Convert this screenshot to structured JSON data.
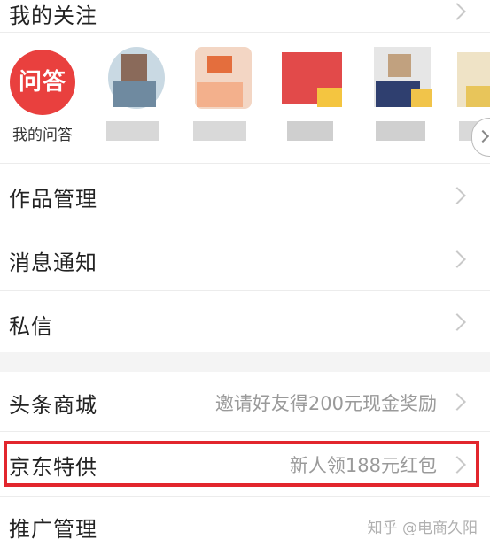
{
  "follow": {
    "title": "我的关注"
  },
  "qa": {
    "badge_text": "问答",
    "label": "我的问答"
  },
  "avatars": [
    {
      "name": "followed-user-1",
      "colors": [
        "#6f8aa0",
        "#c9d9e3",
        "#8a6a5a",
        "#d8d8d8"
      ]
    },
    {
      "name": "followed-user-2",
      "colors": [
        "#f3b08c",
        "#e46e3d",
        "#d9d9d9",
        "#c9c9c9"
      ]
    },
    {
      "name": "followed-user-3",
      "colors": [
        "#e24a4a",
        "#f4c540",
        "#e9e9e9",
        "#cfcfcf"
      ]
    },
    {
      "name": "followed-user-4",
      "colors": [
        "#2f3f6f",
        "#c1a17f",
        "#f1c44a",
        "#d0d0d0"
      ]
    },
    {
      "name": "followed-user-5",
      "colors": [
        "#e8c55a",
        "#d9d9d9",
        "#bdbdbd",
        "#ececec"
      ]
    }
  ],
  "menu": {
    "works": "作品管理",
    "notify": "消息通知",
    "messages": "私信",
    "mall": {
      "label": "头条商城",
      "sub": "邀请好友得200元现金奖励"
    },
    "jd": {
      "label": "京东特供",
      "sub": "新人领188元红包"
    },
    "promo": "推广管理"
  },
  "watermark": "知乎 @电商久阳",
  "colors": {
    "accent_red": "#e9403e",
    "highlight_red": "#e2262d"
  }
}
